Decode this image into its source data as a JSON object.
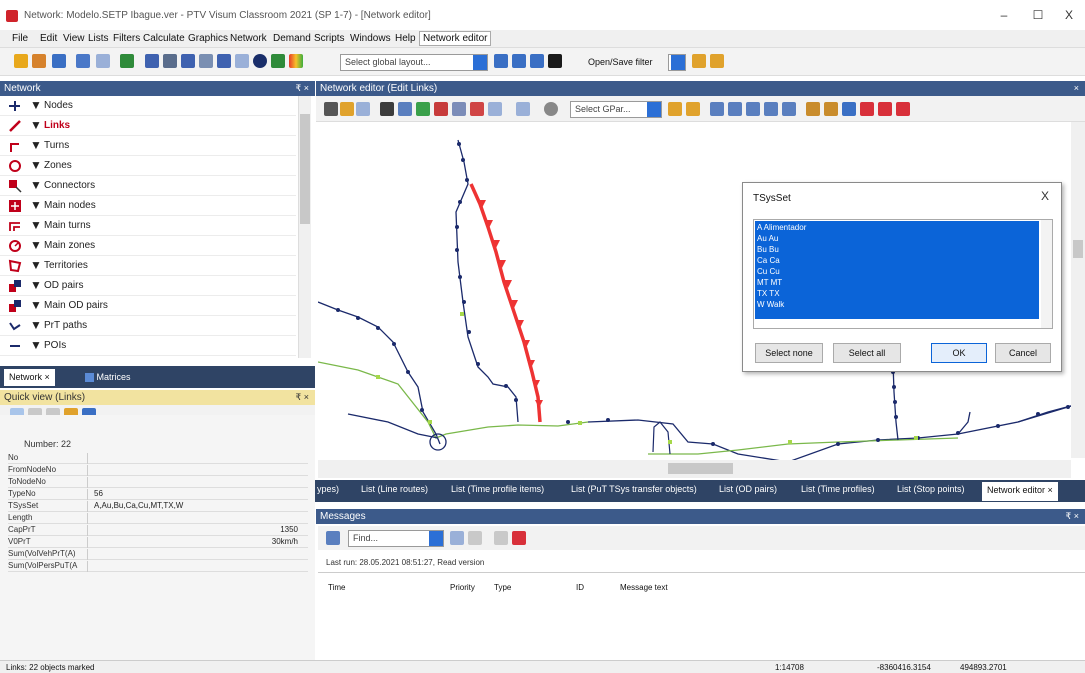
{
  "window": {
    "title": "Network: Modelo.SETP Ibague.ver - PTV Visum Classroom 2021 (SP 1-7) - [Network editor]",
    "minimize": "–",
    "maximize": "☐",
    "close": "X"
  },
  "menu": [
    "File",
    "Edit",
    "View",
    "Lists",
    "Filters",
    "Calculate",
    "Graphics",
    "Network",
    "Demand",
    "Scripts",
    "Windows",
    "Help",
    "Network editor"
  ],
  "toolbar": {
    "global_layout_placeholder": "Select global layout...",
    "open_save_filter": "Open/Save filter"
  },
  "network_panel": {
    "title": "Network",
    "pin": "₹ ×",
    "items": [
      {
        "label": "Nodes",
        "icon": "nodes-icon",
        "color": "#1b2a6b"
      },
      {
        "label": "Links",
        "icon": "links-icon",
        "color": "#c0001a"
      },
      {
        "label": "Turns",
        "icon": "turns-icon",
        "color": "#c0001a"
      },
      {
        "label": "Zones",
        "icon": "zones-icon",
        "color": "#c0001a"
      },
      {
        "label": "Connectors",
        "icon": "connectors-icon",
        "color": "#c0001a"
      },
      {
        "label": "Main nodes",
        "icon": "main-nodes-icon",
        "color": "#c0001a"
      },
      {
        "label": "Main turns",
        "icon": "main-turns-icon",
        "color": "#c0001a"
      },
      {
        "label": "Main zones",
        "icon": "main-zones-icon",
        "color": "#c0001a"
      },
      {
        "label": "Territories",
        "icon": "territories-icon",
        "color": "#c0001a"
      },
      {
        "label": "OD pairs",
        "icon": "od-pairs-icon",
        "color": "#c0001a"
      },
      {
        "label": "Main OD pairs",
        "icon": "main-od-pairs-icon",
        "color": "#c0001a"
      },
      {
        "label": "PrT paths",
        "icon": "prt-paths-icon",
        "color": "#1b2a6b"
      },
      {
        "label": "POIs",
        "icon": "pois-icon",
        "color": "#1b2a6b"
      }
    ]
  },
  "left_tabs": {
    "network": "Network",
    "network_close": "×",
    "matrices": "Matrices"
  },
  "quick_view": {
    "title": "Quick view (Links)",
    "pin": "₹ ×",
    "number_label": "Number: 22",
    "rows": [
      {
        "key": "No",
        "value": ""
      },
      {
        "key": "FromNodeNo",
        "value": ""
      },
      {
        "key": "ToNodeNo",
        "value": ""
      },
      {
        "key": "TypeNo",
        "value": "56"
      },
      {
        "key": "TSysSet",
        "value": "A,Au,Bu,Ca,Cu,MT,TX,W"
      },
      {
        "key": "Length",
        "value": ""
      },
      {
        "key": "CapPrT",
        "value": "1350"
      },
      {
        "key": "V0PrT",
        "value": "30km/h"
      },
      {
        "key": "Sum(VolVehPrT(A)",
        "value": ""
      },
      {
        "key": "Sum(VolPersPuT(A",
        "value": ""
      }
    ]
  },
  "editor": {
    "title": "Network editor (Edit Links)",
    "close": "×",
    "gpar_placeholder": "Select GPar..."
  },
  "dialog": {
    "title": "TSysSet",
    "close": "X",
    "options": [
      "A Alimentador",
      "Au Au",
      "Bu Bu",
      "Ca Ca",
      "Cu Cu",
      "MT MT",
      "TX TX",
      "W Walk"
    ],
    "select_none": "Select none",
    "select_all": "Select all",
    "ok": "OK",
    "cancel": "Cancel"
  },
  "doc_tabs": [
    "ypes)",
    "List (Line routes)",
    "List (Time profile items)",
    "List (PuT TSys transfer objects)",
    "List (OD pairs)",
    "List (Time profiles)",
    "List (Stop points)",
    "Network editor"
  ],
  "doc_tab_close": "×",
  "messages": {
    "title": "Messages",
    "pin": "₹ ×",
    "find_placeholder": "Find...",
    "last_run": "Last run: 28.05.2021 08:51:27, Read version",
    "columns": [
      "Time",
      "Priority",
      "Type",
      "ID",
      "Message text"
    ]
  },
  "status": {
    "left": "Links: 22 objects marked",
    "scale": "1:14708",
    "x": "-8360416.3154",
    "y": "494893.2701"
  }
}
